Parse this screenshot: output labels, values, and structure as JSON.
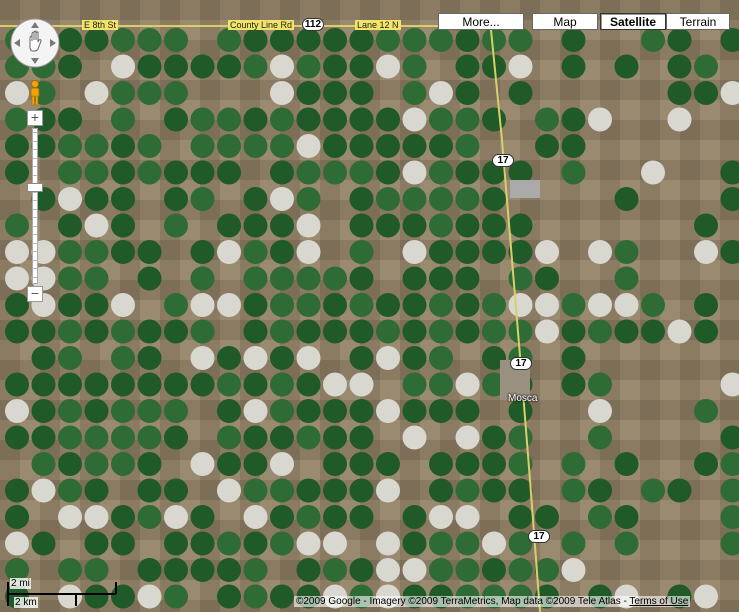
{
  "map": {
    "type_buttons": {
      "more": "More...",
      "map": "Map",
      "satellite": "Satellite",
      "terrain": "Terrain",
      "active": "satellite"
    },
    "road_labels": {
      "e8th": "E 8th St",
      "county_line": "County Line Rd",
      "lane12n": "Lane 12 N"
    },
    "shields": {
      "s112": "112",
      "s17_a": "17",
      "s17_b": "17",
      "s17_c": "17"
    },
    "town": "Mosca",
    "scale": {
      "miles": "2 mi",
      "km": "2 km"
    },
    "copyright": {
      "text": "©2009 Google - Imagery ©2009 TerraMetrics, Map data ©2009 Tele Atlas - ",
      "terms": "Terms of Use"
    },
    "colors": {
      "ground": "#8a7a64",
      "field_dark": "#1f5a28",
      "field_mid": "#2f6b35",
      "field_pale": "#d8d8d0",
      "highway": "#d8cf6a"
    },
    "icons": [
      "pan-icon",
      "pegman-icon",
      "zoom-in-icon",
      "zoom-out-icon"
    ]
  }
}
